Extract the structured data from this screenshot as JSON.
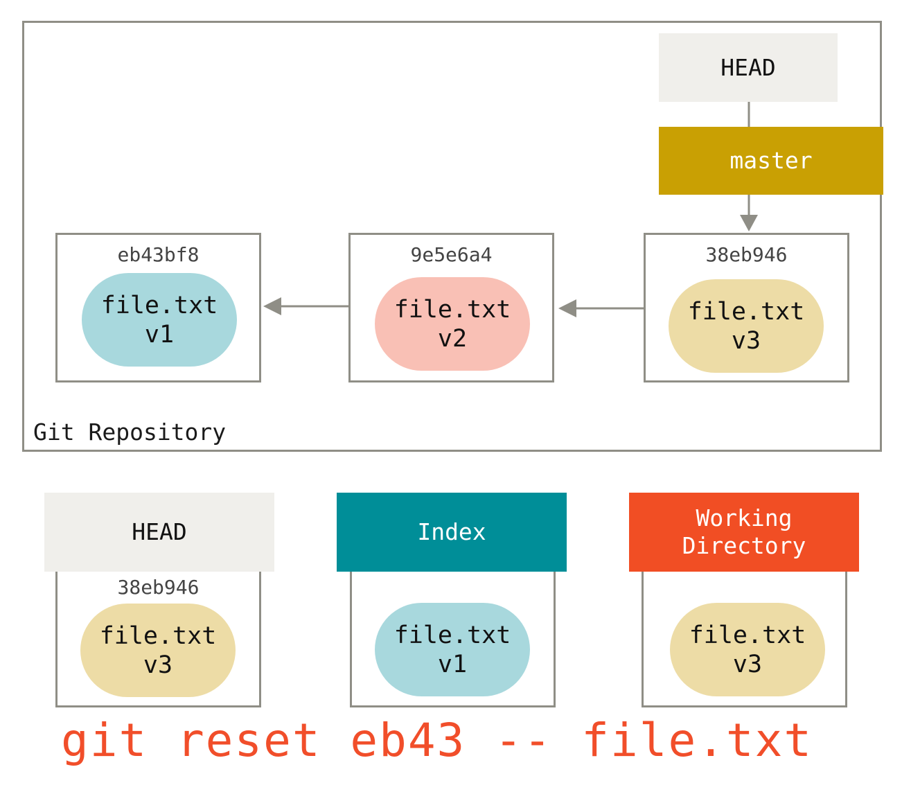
{
  "repository": {
    "label": "Git Repository",
    "head_label": "HEAD",
    "branch_label": "master",
    "commits": [
      {
        "hash": "eb43bf8",
        "file": "file.txt",
        "version": "v1",
        "color": "#a8d8dd"
      },
      {
        "hash": "9e5e6a4",
        "file": "file.txt",
        "version": "v2",
        "color": "#f9c0b5"
      },
      {
        "hash": "38eb946",
        "file": "file.txt",
        "version": "v3",
        "color": "#eddca6"
      }
    ]
  },
  "trees": [
    {
      "label": "HEAD",
      "hash": "38eb946",
      "file": "file.txt",
      "version": "v3",
      "header_color": "#f0efeb",
      "blob_color": "#eddca6"
    },
    {
      "label": "Index",
      "hash": "",
      "file": "file.txt",
      "version": "v1",
      "header_color": "#008e98",
      "blob_color": "#a8d8dd"
    },
    {
      "label": "Working\nDirectory",
      "hash": "",
      "file": "file.txt",
      "version": "v3",
      "header_color": "#f14e24",
      "blob_color": "#eddca6"
    }
  ],
  "command": "git reset eb43 -- file.txt",
  "colors": {
    "border": "#8f8e86",
    "master": "#c9a003",
    "command": "#f14e2a"
  }
}
